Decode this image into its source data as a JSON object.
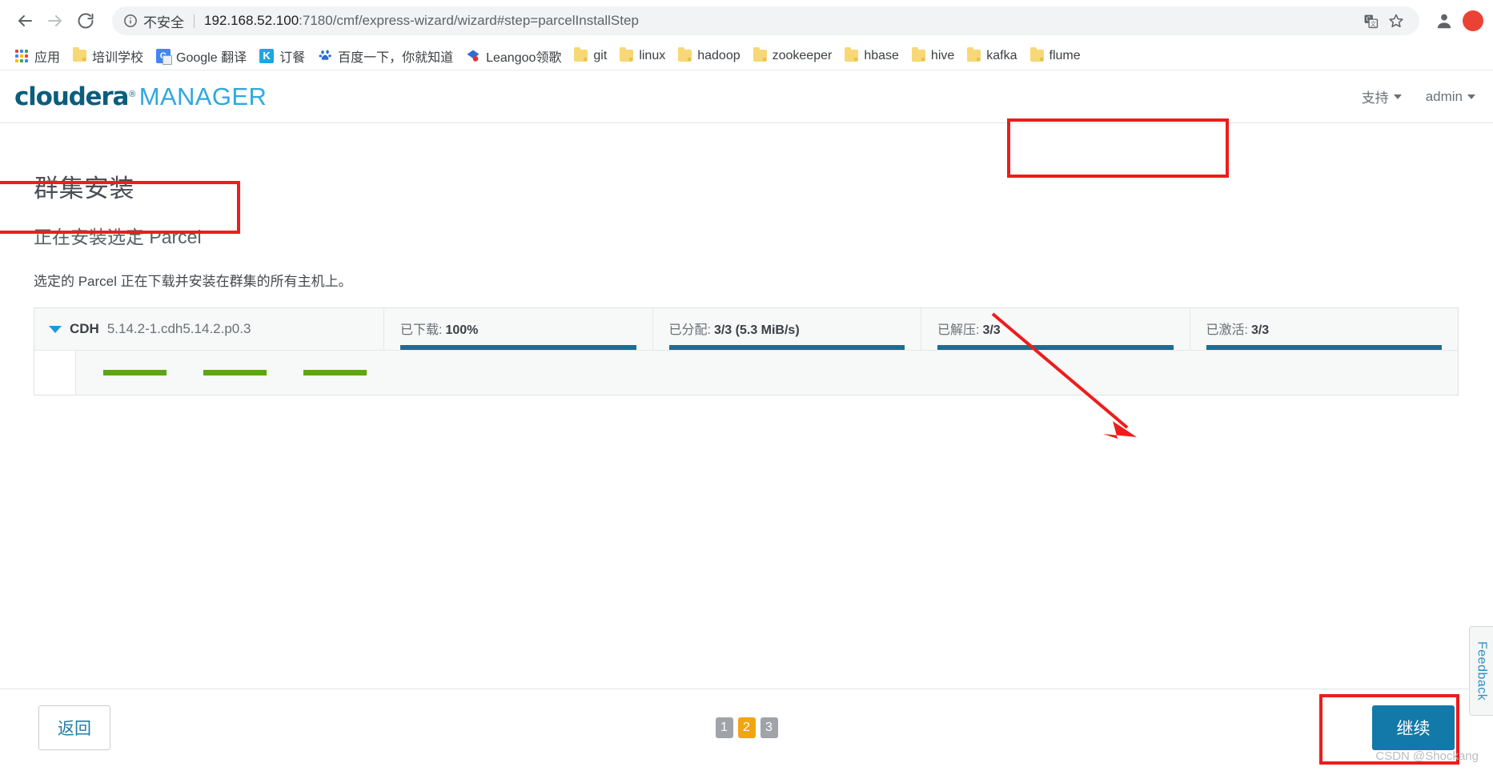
{
  "browser": {
    "nav": {
      "back_icon": "arrow-left-icon",
      "forward_icon": "arrow-right-icon",
      "reload_icon": "reload-icon"
    },
    "omnibox": {
      "info_icon": "info-circle-icon",
      "security_label": "不安全",
      "url_host": "192.168.52.100",
      "url_path": ":7180/cmf/express-wizard/wizard#step=parcelInstallStep",
      "translate_icon": "translate-icon",
      "bookmark_star_icon": "star-icon"
    },
    "toolbar": {
      "profile_icon": "profile-avatar-icon",
      "extension_icon": "red-extension-icon"
    },
    "bookmarks": [
      {
        "label": "应用",
        "icon": "apps-grid-icon"
      },
      {
        "label": "培训学校",
        "icon": "folder-icon"
      },
      {
        "label": "Google 翻译",
        "icon": "google-translate-icon"
      },
      {
        "label": "订餐",
        "icon": "k-app-icon"
      },
      {
        "label": "百度一下，你就知道",
        "icon": "baidu-icon"
      },
      {
        "label": "Leangoo领歌",
        "icon": "leangoo-icon"
      },
      {
        "label": "git",
        "icon": "folder-icon"
      },
      {
        "label": "linux",
        "icon": "folder-icon"
      },
      {
        "label": "hadoop",
        "icon": "folder-icon"
      },
      {
        "label": "zookeeper",
        "icon": "folder-icon"
      },
      {
        "label": "hbase",
        "icon": "folder-icon"
      },
      {
        "label": "hive",
        "icon": "folder-icon"
      },
      {
        "label": "kafka",
        "icon": "folder-icon"
      },
      {
        "label": "flume",
        "icon": "folder-icon"
      }
    ]
  },
  "app": {
    "logo": {
      "primary": "cloudera",
      "registered": "®",
      "secondary": "MANAGER",
      "primary_color": "#0b5d7d",
      "secondary_color": "#2fa8e0"
    },
    "header_links": [
      {
        "label": "支持",
        "has_caret": true
      },
      {
        "label": "admin",
        "has_caret": true
      }
    ],
    "page": {
      "title": "群集安装",
      "subtitle": "正在安装选定 Parcel",
      "description": "选定的 Parcel 正在下载并安装在群集的所有主机上。"
    },
    "parcel": {
      "expand_icon": "chevron-down-icon",
      "name": "CDH",
      "version": "5.14.2-1.cdh5.14.2.p0.3",
      "progress_columns": [
        {
          "label": "已下载:",
          "value": "100%",
          "percent": 100
        },
        {
          "label": "已分配:",
          "value": "3/3 (5.3 MiB/s)",
          "percent": 100
        },
        {
          "label": "已解压:",
          "value": "3/3",
          "percent": 100
        },
        {
          "label": "已激活:",
          "value": "3/3",
          "percent": 100
        }
      ],
      "host_bars": [
        {
          "percent": 100
        },
        {
          "percent": 100
        },
        {
          "percent": 100
        }
      ],
      "host_bar_color": "#5ca514",
      "progress_bar_color": "#1b6e8e"
    },
    "footer": {
      "back_label": "返回",
      "continue_label": "继续",
      "pager": [
        {
          "label": "1",
          "active": false
        },
        {
          "label": "2",
          "active": true
        },
        {
          "label": "3",
          "active": false
        }
      ]
    },
    "feedback_tab_label": "Feedback",
    "watermark": "CSDN @Shockang",
    "annotation_color": "#ee1c1c"
  }
}
